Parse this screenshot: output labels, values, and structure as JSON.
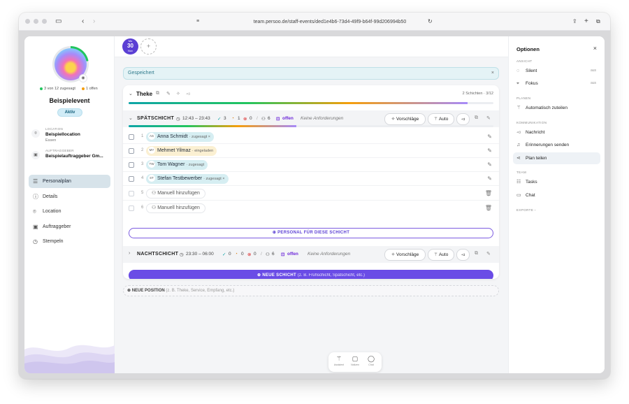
{
  "browser": {
    "url": "team.persoo.de/staff-events/ded1e4b6-73d4-49f9-b64f-99d206994b50"
  },
  "event": {
    "stats_assigned": "3 von 12 zugesagt",
    "stats_open": "1 offen",
    "name": "Beispielevent",
    "status": "Aktiv",
    "location_key": "LOCATION",
    "location_value": "Beispiellocation",
    "location_sub": "Essen",
    "client_key": "AUFTRAGGEBER",
    "client_value": "Beispielauftraggeber Gm..."
  },
  "nav": [
    {
      "label": "Personalplan",
      "icon": "person-icon"
    },
    {
      "label": "Details",
      "icon": "info-icon"
    },
    {
      "label": "Location",
      "icon": "pin-icon"
    },
    {
      "label": "Auftraggeber",
      "icon": "briefcase-icon"
    },
    {
      "label": "Stempeln",
      "icon": "stopwatch-icon"
    }
  ],
  "day": {
    "month": "Mo",
    "date": "30",
    "weekday": "Nov"
  },
  "saved_text": "Gespeichert",
  "position": {
    "title": "Theke",
    "count": "2 Schichten · 3/12",
    "progress": 0.93
  },
  "shifts": [
    {
      "name": "SPÄTSCHICHT",
      "time": "12:43 – 23:43",
      "ok": "3",
      "pending": "1",
      "declined": "0",
      "people": "6",
      "open_label": "offen",
      "requirements": "Keine Anforderungen",
      "progress": 0.46
    },
    {
      "name": "NACHTSCHICHT",
      "time": "23:30 – 06:00",
      "ok": "0",
      "pending": "0",
      "declined": "0",
      "people": "6",
      "open_label": "offen",
      "requirements": "Keine Anforderungen"
    }
  ],
  "shift_buttons": {
    "suggestions": "Vorschläge",
    "auto": "Auto"
  },
  "staff_rows": [
    {
      "num": "1",
      "initials": "AS",
      "name": "Anna Schmidt",
      "status": "· zugesagt ×",
      "color": "#d6eef2"
    },
    {
      "num": "2",
      "initials": "MY",
      "name": "Mehmet Yilmaz",
      "status": "· eingeladen",
      "color": "#fbf0d2"
    },
    {
      "num": "3",
      "initials": "TW",
      "name": "Tom Wagner",
      "status": "· zugesagt",
      "color": "#d6eef2"
    },
    {
      "num": "4",
      "initials": "ST",
      "name": "Stefan Testbewerber",
      "status": "· zugesagt ×",
      "color": "#d6eef2"
    },
    {
      "num": "5",
      "name": "Manuell hinzufügen"
    },
    {
      "num": "6",
      "name": "Manuell hinzufügen"
    }
  ],
  "add_staff_button": "PERSONAL FÜR DIESE SCHICHT",
  "new_shift": {
    "label": "NEUE SCHICHT",
    "hint": "(z. B. Frühschicht, Spätschicht, etc.)"
  },
  "new_position": {
    "label": "NEUE POSITION",
    "hint": "(z. B. Theke, Service, Empfang, etc.)"
  },
  "dock": [
    {
      "label": "Assistent",
      "icon": "magic-wand-icon"
    },
    {
      "label": "Notizen",
      "icon": "note-icon"
    },
    {
      "label": "Chat",
      "icon": "chat-icon"
    }
  ],
  "options": {
    "title": "Optionen",
    "sections": {
      "ansicht": "ANSICHT",
      "planen": "PLANEN",
      "kommunikation": "KOMMUNIKATION",
      "team": "TEAM",
      "exporte": "EXPORTE ›"
    },
    "silent": "Silent",
    "silent_state": "aus",
    "fokus": "Fokus",
    "fokus_state": "aus",
    "auto_fill": "Automatisch zuteilen",
    "message": "Nachricht",
    "reminders": "Erinnerungen senden",
    "share": "Plan teilen",
    "tasks": "Tasks",
    "chat": "Chat"
  },
  "colors": {
    "accent": "#6a4ce6",
    "active_nav": "#d7e3ea",
    "saved_bg": "#e4f3f6"
  }
}
